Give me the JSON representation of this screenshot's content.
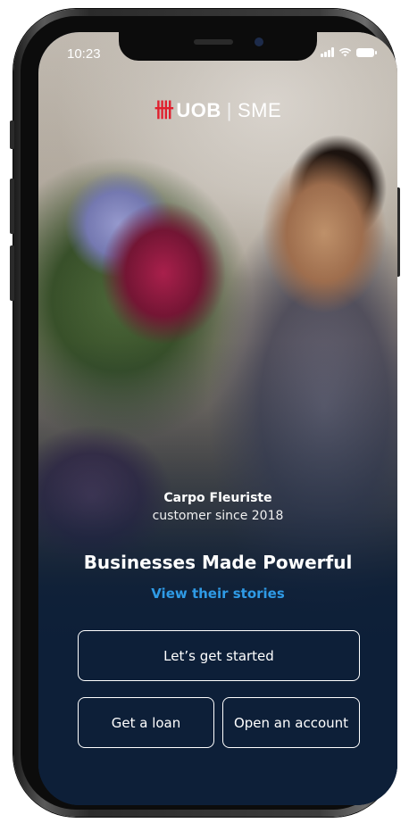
{
  "status_bar": {
    "time": "10:23"
  },
  "brand": {
    "bank": "UOB",
    "divider": "|",
    "segment": "SME",
    "accent_color": "#e0202e"
  },
  "story": {
    "customer_name": "Carpo Fleuriste",
    "customer_since": "customer since 2018",
    "headline": "Businesses Made Powerful",
    "link_label": "View their stories"
  },
  "actions": {
    "primary": "Let’s get started",
    "loan": "Get a loan",
    "account": "Open an account"
  },
  "colors": {
    "background": "#0d1f38",
    "link": "#2f9be6"
  }
}
